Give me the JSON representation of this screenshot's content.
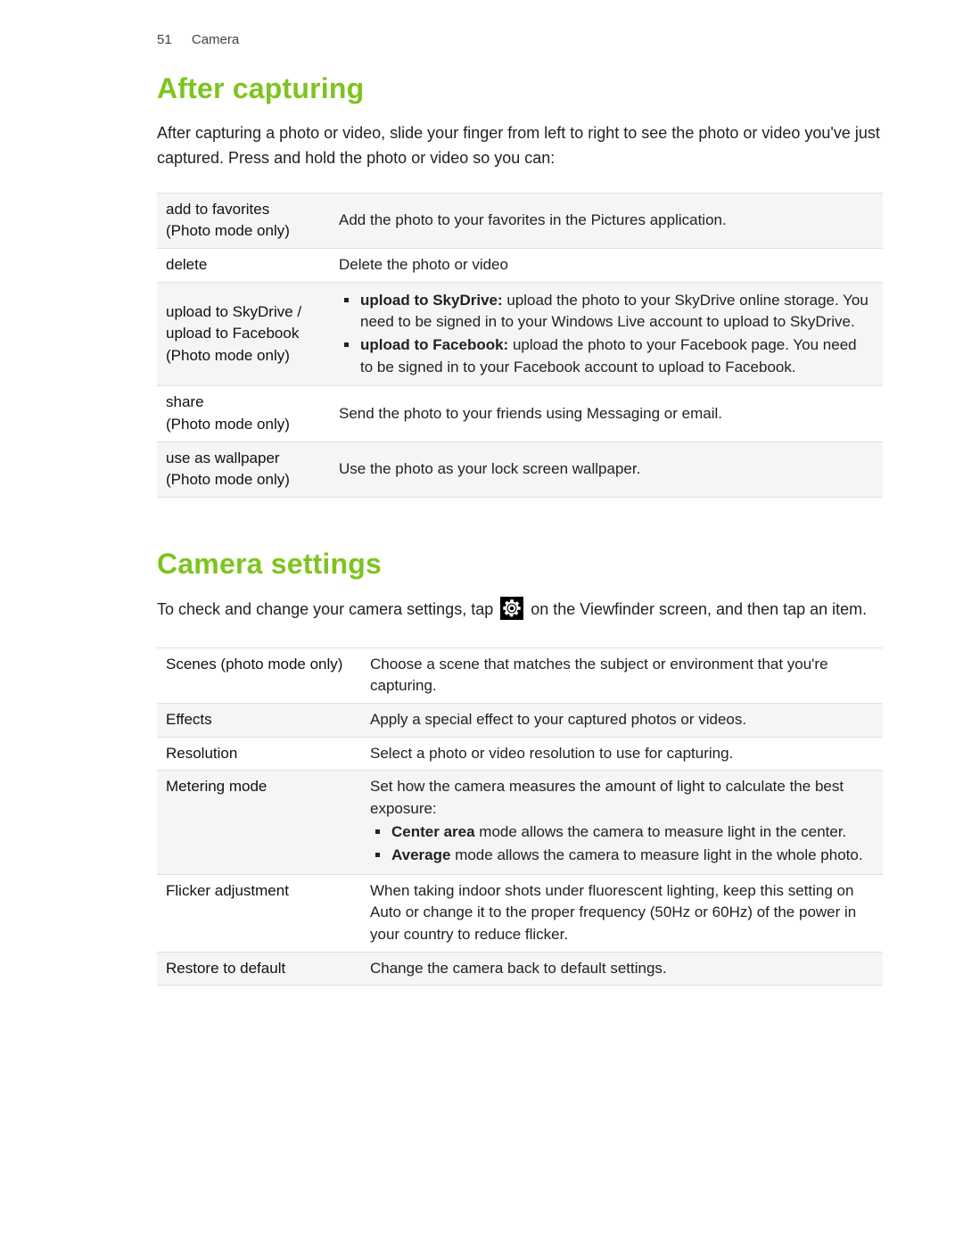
{
  "header": {
    "page_number": "51",
    "section": "Camera"
  },
  "section1": {
    "title": "After capturing",
    "intro": "After capturing a photo or video, slide your finger from left to right to see the photo or video you've just captured. Press and hold the photo or video so you can:",
    "rows": {
      "r0": {
        "k1": "add to favorites",
        "k2": "(Photo mode only)",
        "desc": "Add the photo to your favorites in the Pictures application."
      },
      "r1": {
        "k1": "delete",
        "desc": "Delete the photo or video"
      },
      "r2": {
        "k1": "upload to SkyDrive / upload to Facebook",
        "k2": "(Photo mode only)",
        "b1_bold": "upload to SkyDrive:",
        "b1_rest": " upload the photo to your SkyDrive online storage. You need to be signed in to your Windows Live account to upload to SkyDrive.",
        "b2_bold": "upload to Facebook:",
        "b2_rest": " upload the photo to your Facebook page. You need to be signed in to your Facebook account to upload to Facebook."
      },
      "r3": {
        "k1": "share",
        "k2": "(Photo mode only)",
        "desc": "Send the photo to your friends using Messaging or email."
      },
      "r4": {
        "k1": "use as wallpaper",
        "k2": "(Photo mode only)",
        "desc": "Use the photo as your lock screen wallpaper."
      }
    }
  },
  "section2": {
    "title": "Camera settings",
    "intro_before": "To check and change your camera settings, tap ",
    "intro_after": " on the Viewfinder screen, and then tap an item.",
    "icon_name": "settings-gear-icon",
    "rows": {
      "r0": {
        "k": "Scenes (photo mode only)",
        "d": "Choose a scene that matches the subject or environment that you're capturing."
      },
      "r1": {
        "k": "Effects",
        "d": "Apply a special effect to your captured photos or videos."
      },
      "r2": {
        "k": "Resolution",
        "d": "Select a photo or video resolution to use for capturing."
      },
      "r3": {
        "k": "Metering mode",
        "intro": "Set how the camera measures the amount of light to calculate the best exposure:",
        "b1_bold": "Center area",
        "b1_rest": " mode allows the camera to measure light in the center.",
        "b2_bold": "Average",
        "b2_rest": " mode allows the camera to measure light in the whole photo."
      },
      "r4": {
        "k": "Flicker adjustment",
        "d": "When taking indoor shots under fluorescent lighting, keep this setting on Auto or change it to the proper frequency (50Hz or 60Hz) of the power in your country to reduce flicker."
      },
      "r5": {
        "k": "Restore to default",
        "d": "Change the camera back to default settings."
      }
    }
  }
}
